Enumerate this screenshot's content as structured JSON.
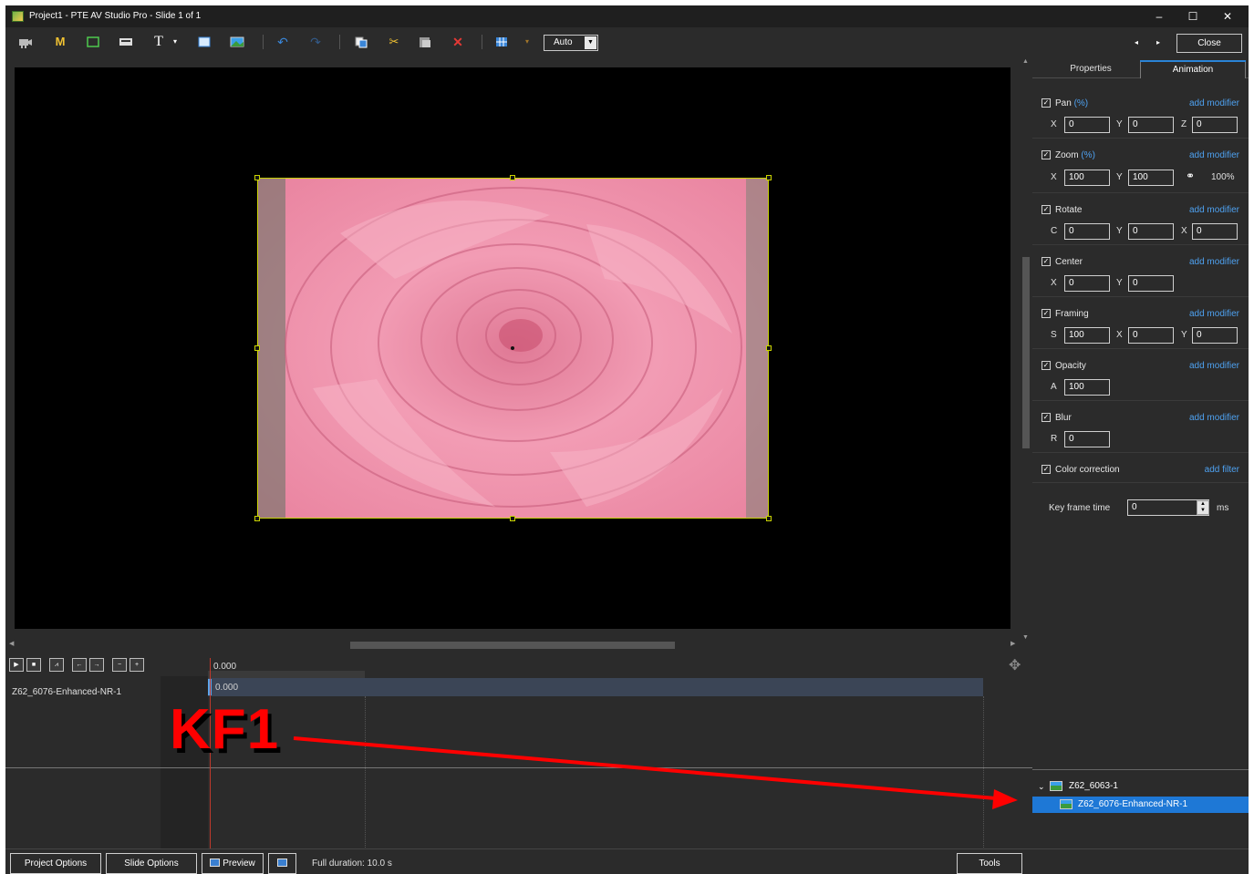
{
  "window": {
    "title": "Project1 - PTE AV Studio Pro - Slide 1 of 1",
    "minimize": "–",
    "maximize": "☐",
    "close": "✕"
  },
  "toolbar": {
    "icons": [
      "camera-icon",
      "m-icon",
      "rectangle-icon",
      "subtitle-icon",
      "text-icon",
      "frame-icon",
      "image-icon",
      "undo-icon",
      "redo-icon",
      "copy-icon",
      "cut-icon",
      "paste-icon",
      "delete-icon",
      "grid-icon"
    ],
    "m_label": "M",
    "text_label": "T",
    "auto_value": "Auto",
    "close_label": "Close",
    "prev_arrow": "◂",
    "next_arrow": "▸"
  },
  "right_panel": {
    "tabs": [
      "Properties",
      "Animation"
    ],
    "active_tab": "Animation",
    "sections": {
      "pan": {
        "title": "Pan",
        "unit": "(%)",
        "link": "add modifier",
        "fields": [
          {
            "label": "X",
            "value": "0"
          },
          {
            "label": "Y",
            "value": "0"
          },
          {
            "label": "Z",
            "value": "0"
          }
        ]
      },
      "zoom": {
        "title": "Zoom",
        "unit": "(%)",
        "link": "add modifier",
        "fields": [
          {
            "label": "X",
            "value": "100"
          },
          {
            "label": "Y",
            "value": "100"
          }
        ],
        "percent": "100%"
      },
      "rotate": {
        "title": "Rotate",
        "link": "add modifier",
        "fields": [
          {
            "label": "C",
            "value": "0"
          },
          {
            "label": "Y",
            "value": "0"
          },
          {
            "label": "X",
            "value": "0"
          }
        ]
      },
      "center": {
        "title": "Center",
        "link": "add modifier",
        "fields": [
          {
            "label": "X",
            "value": "0"
          },
          {
            "label": "Y",
            "value": "0"
          }
        ]
      },
      "framing": {
        "title": "Framing",
        "link": "add modifier",
        "fields": [
          {
            "label": "S",
            "value": "100"
          },
          {
            "label": "X",
            "value": "0"
          },
          {
            "label": "Y",
            "value": "0"
          }
        ]
      },
      "opacity": {
        "title": "Opacity",
        "link": "add modifier",
        "fields": [
          {
            "label": "A",
            "value": "100"
          }
        ]
      },
      "blur": {
        "title": "Blur",
        "link": "add modifier",
        "fields": [
          {
            "label": "R",
            "value": "0"
          }
        ]
      },
      "color_correction": {
        "title": "Color correction",
        "link": "add filter"
      }
    },
    "keyframe_time_label": "Key frame time",
    "keyframe_time_value": "0",
    "keyframe_unit": "ms"
  },
  "timeline": {
    "time_header": "0.000",
    "track_name": "Z62_6076-Enhanced-NR-1",
    "keyframe_time": "0.000",
    "controls": [
      "▶",
      "■",
      "⩘",
      "←",
      "→",
      "−",
      "+"
    ]
  },
  "tree": {
    "parent": "Z62_6063-1",
    "child": "Z62_6076-Enhanced-NR-1",
    "chevron": "⌄"
  },
  "annotation": {
    "label": "KF1",
    "color": "#ff0000"
  },
  "bottom_bar": {
    "project_options": "Project Options",
    "slide_options": "Slide Options",
    "preview": "Preview",
    "full_duration": "Full duration: 10.0 s",
    "tools": "Tools"
  },
  "colors": {
    "accent": "#1e78d6",
    "link": "#4ea1f0",
    "selection_frame": "#c8d200",
    "playhead": "#c0392b"
  }
}
